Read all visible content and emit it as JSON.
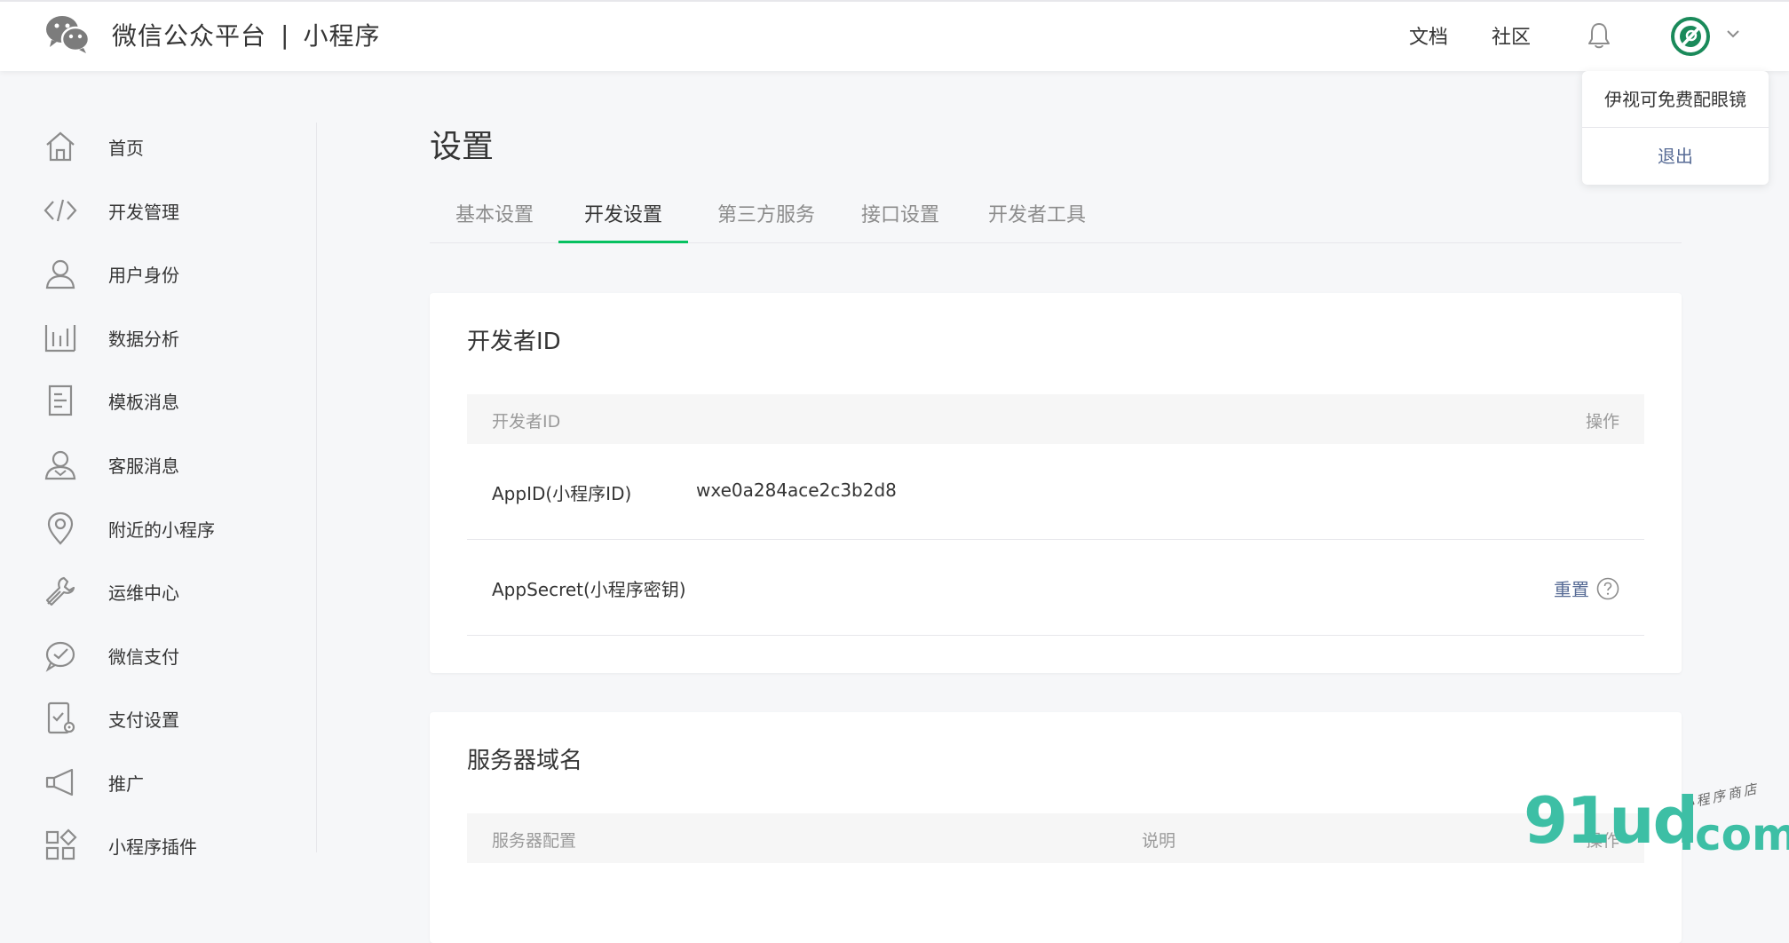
{
  "header": {
    "brand_name": "微信公众平台",
    "brand_separator": "|",
    "brand_product": "小程序",
    "nav": [
      {
        "label": "文档"
      },
      {
        "label": "社区"
      }
    ]
  },
  "account_menu": {
    "account_name": "伊视可免费配眼镜",
    "logout": "退出"
  },
  "sidebar": {
    "items": [
      {
        "label": "首页",
        "icon": "home-icon"
      },
      {
        "label": "开发管理",
        "icon": "code-icon"
      },
      {
        "label": "用户身份",
        "icon": "user-icon"
      },
      {
        "label": "数据分析",
        "icon": "chart-icon"
      },
      {
        "label": "模板消息",
        "icon": "document-icon"
      },
      {
        "label": "客服消息",
        "icon": "customer-service-icon"
      },
      {
        "label": "附近的小程序",
        "icon": "location-icon"
      },
      {
        "label": "运维中心",
        "icon": "wrench-icon"
      },
      {
        "label": "微信支付",
        "icon": "wechat-pay-icon"
      },
      {
        "label": "支付设置",
        "icon": "payment-settings-icon"
      },
      {
        "label": "推广",
        "icon": "megaphone-icon"
      },
      {
        "label": "小程序插件",
        "icon": "plugin-icon"
      }
    ]
  },
  "main": {
    "title": "设置",
    "tabs": [
      {
        "label": "基本设置",
        "active": false
      },
      {
        "label": "开发设置",
        "active": true
      },
      {
        "label": "第三方服务",
        "active": false
      },
      {
        "label": "接口设置",
        "active": false
      },
      {
        "label": "开发者工具",
        "active": false
      }
    ],
    "developer_id": {
      "title": "开发者ID",
      "headers": {
        "id": "开发者ID",
        "action": "操作"
      },
      "rows": [
        {
          "key": "AppID(小程序ID)",
          "value": "wxe0a284ace2c3b2d8",
          "action": ""
        },
        {
          "key": "AppSecret(小程序密钥)",
          "value": "",
          "action": "重置"
        }
      ]
    },
    "server_domain": {
      "title": "服务器域名",
      "headers": {
        "config": "服务器配置",
        "desc": "说明",
        "action": "操作"
      }
    }
  },
  "watermark": {
    "text": "91ud",
    "suffix": ".com",
    "tagline": "小程序商店"
  },
  "colors": {
    "accent": "#07c160",
    "link": "#576b95",
    "watermark": "#3dbfa5"
  }
}
